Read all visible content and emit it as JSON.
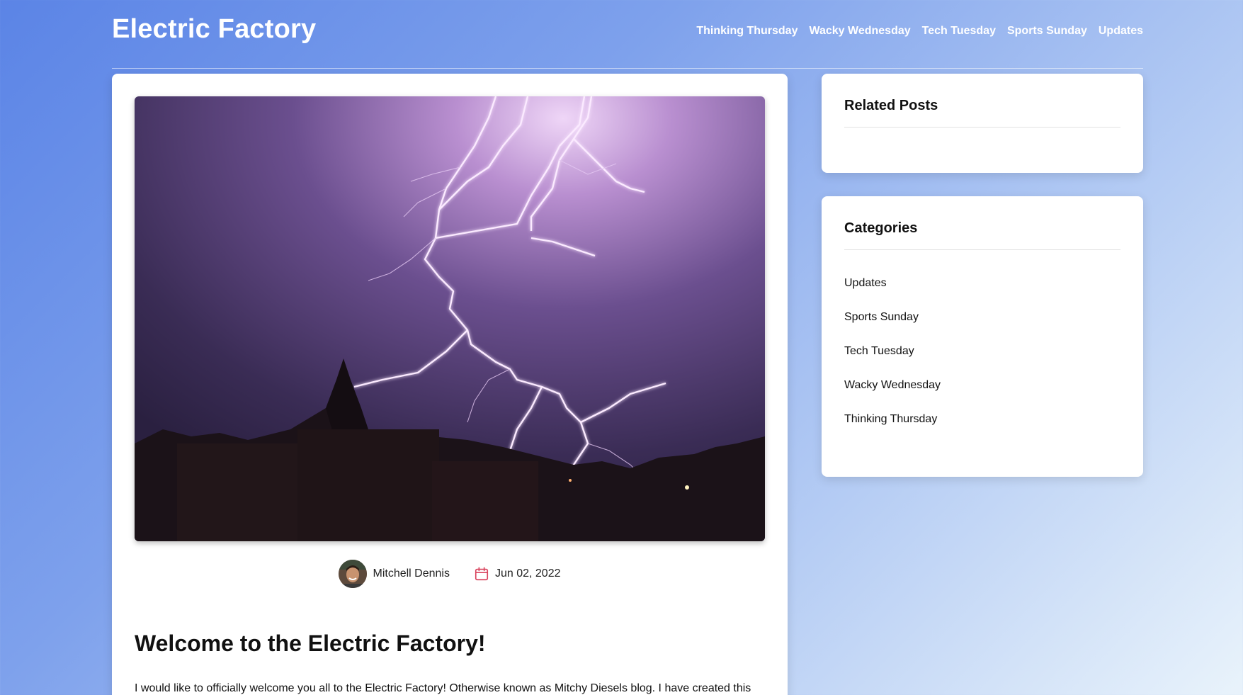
{
  "header": {
    "site_title": "Electric Factory",
    "nav": [
      "Thinking Thursday",
      "Wacky Wednesday",
      "Tech Tuesday",
      "Sports Sunday",
      "Updates"
    ]
  },
  "post": {
    "author": "Mitchell Dennis",
    "date": "Jun 02, 2022",
    "title": "Welcome to the Electric Factory!",
    "body_first_line": "I would like to officially welcome you all to the Electric Factory! Otherwise known as Mitchy Diesels blog. I have created this"
  },
  "sidebar": {
    "related_title": "Related Posts",
    "categories_title": "Categories",
    "categories": [
      "Updates",
      "Sports Sunday",
      "Tech Tuesday",
      "Wacky Wednesday",
      "Thinking Thursday"
    ]
  },
  "icons": {
    "hero": "lightning-photo",
    "avatar": "author-avatar",
    "date": "calendar-icon"
  },
  "colors": {
    "accent_calendar": "#d9455f",
    "gradient_start": "#5b84e6",
    "gradient_end": "#e9f3fb"
  }
}
